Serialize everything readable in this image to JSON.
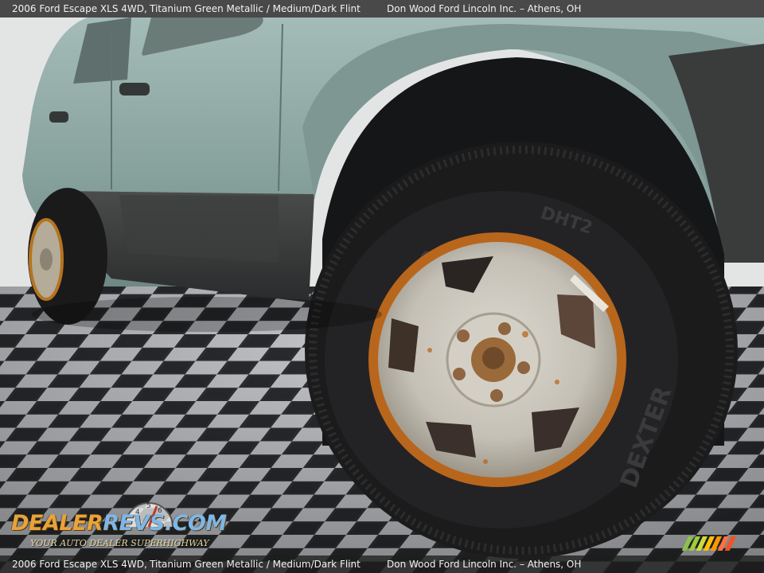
{
  "caption": {
    "vehicle": "2006 Ford Escape XLS 4WD,",
    "color": "Titanium Green Metallic / Medium/Dark Flint",
    "dealer": "Don Wood Ford Lincoln Inc. – Athens, OH"
  },
  "watermark": {
    "brand_dealer": "DEALER",
    "brand_revs": "REVS",
    "brand_suffix": ".COM",
    "tagline": "YOUR AUTO DEALER SUPERHIGHWAY",
    "gauge_icon": "speedometer-icon"
  },
  "tire": {
    "brand_text": "DEXTER",
    "model_text": "DHT2"
  },
  "colors": {
    "body_paint": "#8fa8a3",
    "tire": "#1b1b1c",
    "wheel": "#c9c6bd",
    "rust": "#b9661d",
    "floor_light": "#c6c8cb",
    "floor_dark": "#3b3d40"
  }
}
